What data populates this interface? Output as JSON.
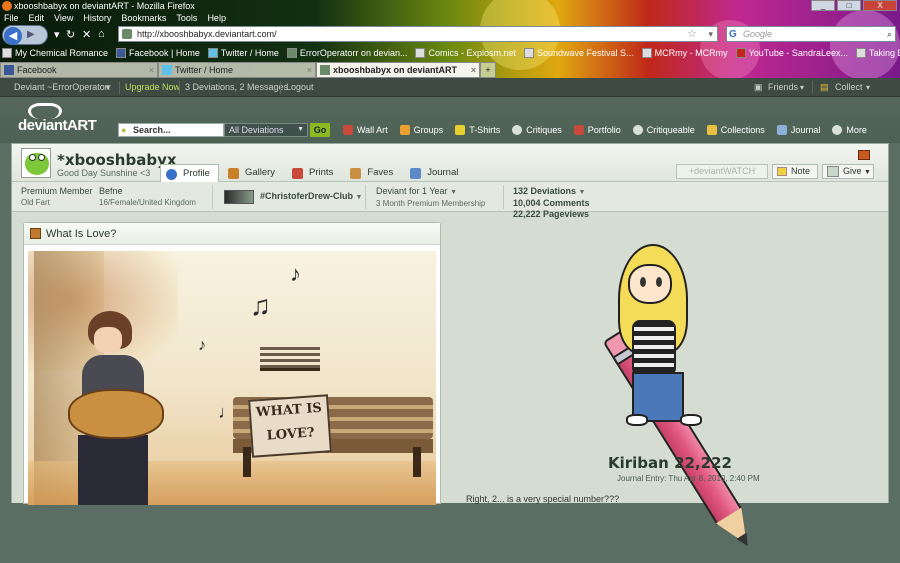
{
  "browser": {
    "window_title": "xbooshbabyx on deviantART - Mozilla Firefox",
    "window_buttons": [
      "_",
      "□",
      "X"
    ],
    "menu": [
      "File",
      "Edit",
      "View",
      "History",
      "Bookmarks",
      "Tools",
      "Help"
    ],
    "url": "http://xbooshbabyx.deviantart.com/",
    "search_placeholder": "Google",
    "bookmarks": [
      "My Chemical Romance",
      "Facebook | Home",
      "Twitter / Home",
      "ErrorOperatorr on devian...",
      "Comics - Explosm.net",
      "Soundwave Festival S...",
      "MCRmy - MCRmy",
      "YouTube - SandraLeex...",
      "Taking Back Sunday..."
    ],
    "tabs": [
      {
        "label": "Facebook",
        "close": "×"
      },
      {
        "label": "Twitter / Home",
        "close": "×"
      },
      {
        "label": "xbooshbabyx on deviantART",
        "close": "×"
      }
    ],
    "new_tab": "+"
  },
  "da_bar": {
    "account": "Deviant ~ErrorOperatorr",
    "upgrade": "Upgrade Now",
    "messages": "3 Deviations, 2 Messages",
    "logout": "Logout",
    "friends": "Friends",
    "collect": "Collect"
  },
  "da_header": {
    "logo": "deviantART",
    "search_label": "Search...",
    "search_scope": "All Deviations",
    "go": "Go",
    "nav": [
      "Wall Art",
      "Groups",
      "T-Shirts",
      "Critiques",
      "Portfolio",
      "Critiqueable",
      "Collections",
      "Journal",
      "More"
    ]
  },
  "profile": {
    "username": "*xbooshbabyx",
    "tagline": "Good Day Sunshine <3",
    "tabs": [
      "Profile",
      "Gallery",
      "Prints",
      "Faves",
      "Journal"
    ],
    "watch": "+deviantWATCH",
    "note": "Note",
    "give": "Give",
    "info": {
      "member_type": "Premium Member",
      "member_sub": "Old Fart",
      "name": "Befne",
      "details": "16/Female/United Kingdom",
      "group": "#ChristoferDrew-Club",
      "deviant_for": "Deviant for 1 Year",
      "premium": "3 Month Premium Membership",
      "stats": [
        "132 Deviations",
        "10,004 Comments",
        "22,222 Pageviews"
      ]
    }
  },
  "journal_panel": {
    "title": "What Is Love?",
    "sign_text": "WHAT IS LOVE?"
  },
  "featured": {
    "title": "Kiriban 22,222",
    "entry": "Journal Entry: Thu Apr 8, 2010, 2:40 PM",
    "body_start": "Right, 2... is a very special number???"
  },
  "colors": {
    "da_green": "#4e6155",
    "profile_bg": "#d5ddd3",
    "accent_go": "#8cb820"
  }
}
